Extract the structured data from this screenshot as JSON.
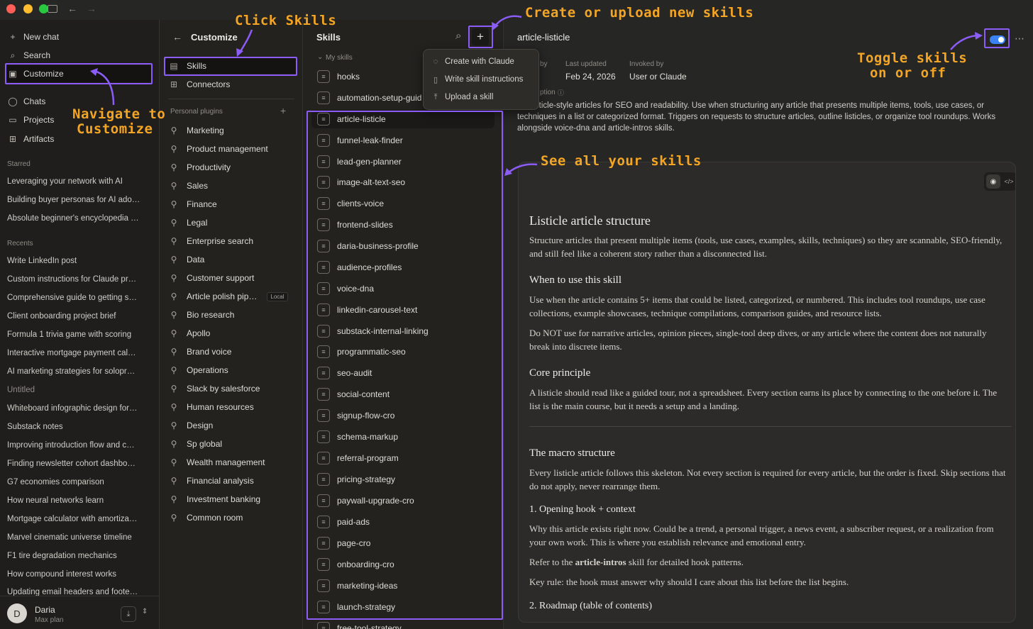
{
  "colors": {
    "accent": "#8b5cf6",
    "annotation": "#f5a524",
    "toggle": "#3b82f6"
  },
  "sidebar": {
    "new_chat": "New chat",
    "search": "Search",
    "customize": "Customize",
    "chats": "Chats",
    "projects": "Projects",
    "artifacts": "Artifacts",
    "starred_heading": "Starred",
    "starred": [
      "Leveraging your network with AI",
      "Building buyer personas for AI ado…",
      "Absolute beginner's encyclopedia …"
    ],
    "recents_heading": "Recents",
    "recents": [
      "Write LinkedIn post",
      "Custom instructions for Claude pr…",
      "Comprehensive guide to getting s…",
      "Client onboarding project brief",
      "Formula 1 trivia game with scoring",
      "Interactive mortgage payment cal…",
      "AI marketing strategies for solopr…",
      "Untitled",
      "Whiteboard infographic design for…",
      "Substack notes",
      "Improving introduction flow and c…",
      "Finding newsletter cohort dashbo…",
      "G7 economies comparison",
      "How neural networks learn",
      "Mortgage calculator with amortiza…",
      "Marvel cinematic universe timeline",
      "F1 tire degradation mechanics",
      "How compound interest works",
      "Updating email headers and foote…"
    ],
    "user": {
      "initial": "D",
      "name": "Daria",
      "plan": "Max plan"
    }
  },
  "customize": {
    "title": "Customize",
    "skills": "Skills",
    "connectors": "Connectors",
    "plugins_heading": "Personal plugins",
    "plugins": [
      "Marketing",
      "Product management",
      "Productivity",
      "Sales",
      "Finance",
      "Legal",
      "Enterprise search",
      "Data",
      "Customer support",
      "Article polish pip…",
      "Bio research",
      "Apollo",
      "Brand voice",
      "Operations",
      "Slack by salesforce",
      "Human resources",
      "Design",
      "Sp global",
      "Wealth management",
      "Financial analysis",
      "Investment banking",
      "Common room"
    ],
    "local_badge": "Local"
  },
  "skills_panel": {
    "title": "Skills",
    "my_skills": "My skills",
    "items": [
      "hooks",
      "automation-setup-guid",
      "article-listicle",
      "funnel-leak-finder",
      "lead-gen-planner",
      "image-alt-text-seo",
      "clients-voice",
      "frontend-slides",
      "daria-business-profile",
      "audience-profiles",
      "voice-dna",
      "linkedin-carousel-text",
      "substack-internal-linking",
      "programmatic-seo",
      "seo-audit",
      "social-content",
      "signup-flow-cro",
      "schema-markup",
      "referral-program",
      "pricing-strategy",
      "paywall-upgrade-cro",
      "paid-ads",
      "page-cro",
      "onboarding-cro",
      "marketing-ideas",
      "launch-strategy",
      "free-tool-strategy"
    ]
  },
  "menu": {
    "create": "Create with Claude",
    "write": "Write skill instructions",
    "upload": "Upload a skill"
  },
  "detail": {
    "title": "article-listicle",
    "added_by_label": "by",
    "last_updated_label": "Last updated",
    "last_updated": "Feb 24, 2026",
    "invoked_by_label": "Invoked by",
    "invoked_by": "User or Claude",
    "description_label": "ption",
    "description": "ure listicle-style articles for SEO and readability. Use when structuring any article that presents multiple items, tools, use cases, or techniques in a list or categorized format. Triggers on requests to structure articles, outline listicles, or organize tool roundups. Works alongside voice-dna and article-intros skills.",
    "doc": {
      "h1": "Listicle article structure",
      "p1": "Structure articles that present multiple items (tools, use cases, examples, skills, techniques) so they are scannable, SEO-friendly, and still feel like a coherent story rather than a disconnected list.",
      "h_when": "When to use this skill",
      "p_when1": "Use when the article contains 5+ items that could be listed, categorized, or numbered. This includes tool roundups, use case collections, example showcases, technique compilations, comparison guides, and resource lists.",
      "p_when2": "Do NOT use for narrative articles, opinion pieces, single-tool deep dives, or any article where the content does not naturally break into discrete items.",
      "h_core": "Core principle",
      "p_core": "A listicle should read like a guided tour, not a spreadsheet. Every section earns its place by connecting to the one before it. The list is the main course, but it needs a setup and a landing.",
      "h_macro": "The macro structure",
      "p_macro": "Every listicle article follows this skeleton. Not every section is required for every article, but the order is fixed. Skip sections that do not apply, never rearrange them.",
      "h_open": "1. Opening hook + context",
      "p_open": "Why this article exists right now. Could be a trend, a personal trigger, a news event, a subscriber request, or a realization from your own work. This is where you establish relevance and emotional entry.",
      "p_refer_pre": "Refer to the ",
      "p_refer_bold": "article-intros",
      "p_refer_post": " skill for detailed hook patterns.",
      "p_key": "Key rule: the hook must answer why should I care about this list before the list begins.",
      "h_roadmap": "2. Roadmap (table of contents)"
    }
  },
  "annotations": {
    "click_skills": "Click Skills",
    "create_upload": "Create or upload new skills",
    "navigate": [
      "Navigate to",
      "Customize"
    ],
    "toggle": [
      "Toggle skills",
      "on or off"
    ],
    "see_all": "See all your skills"
  }
}
